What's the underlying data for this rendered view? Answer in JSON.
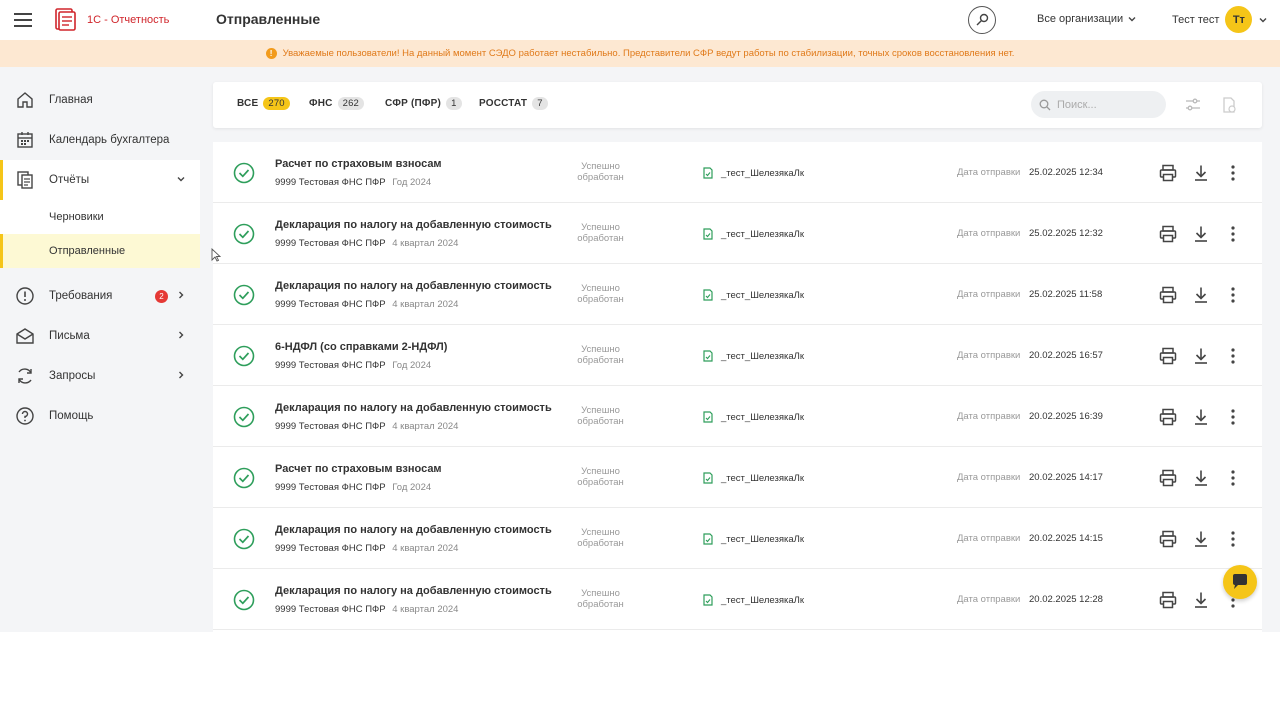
{
  "header": {
    "brand": "1С - Отчетность",
    "title": "Отправленные",
    "org_select": "Все организации",
    "user_name": "Тест тест",
    "avatar_initials": "Тт"
  },
  "alert": {
    "text": "Уважаемые пользователи! На данный момент СЭДО работает нестабильно. Представители СФР ведут работы по стабилизации, точных сроков восстановления нет."
  },
  "sidebar": {
    "items": [
      {
        "label": "Главная",
        "icon": "home-icon"
      },
      {
        "label": "Календарь бухгалтера",
        "icon": "calendar-icon"
      },
      {
        "label": "Отчёты",
        "icon": "reports-icon"
      },
      {
        "label": "Требования",
        "icon": "alert-circle-icon",
        "badge": "2"
      },
      {
        "label": "Письма",
        "icon": "mail-icon"
      },
      {
        "label": "Запросы",
        "icon": "refresh-icon"
      },
      {
        "label": "Помощь",
        "icon": "help-icon"
      }
    ],
    "sub_items": [
      {
        "label": "Черновики"
      },
      {
        "label": "Отправленные"
      }
    ]
  },
  "filters": {
    "tabs": [
      {
        "label": "ВСЕ",
        "count": "270"
      },
      {
        "label": "ФНС",
        "count": "262"
      },
      {
        "label": "СФР (ПФР)",
        "count": "1"
      },
      {
        "label": "РОССТАТ",
        "count": "7"
      }
    ],
    "search_placeholder": "Поиск..."
  },
  "reports": {
    "date_label": "Дата отправки",
    "rows": [
      {
        "title": "Расчет по страховым взносам",
        "code": "9999",
        "org": "Тестовая ФНС ПФР",
        "period": "Год 2024",
        "state_line1": "Успешно",
        "state_line2": "обработан",
        "signer": "_тест_ШелезякаЛк",
        "date": "25.02.2025 12:34"
      },
      {
        "title": "Декларация по налогу на добавленную стоимость",
        "code": "9999",
        "org": "Тестовая ФНС ПФР",
        "period": "4 квартал 2024",
        "state_line1": "Успешно",
        "state_line2": "обработан",
        "signer": "_тест_ШелезякаЛк",
        "date": "25.02.2025 12:32"
      },
      {
        "title": "Декларация по налогу на добавленную стоимость",
        "code": "9999",
        "org": "Тестовая ФНС ПФР",
        "period": "4 квартал 2024",
        "state_line1": "Успешно",
        "state_line2": "обработан",
        "signer": "_тест_ШелезякаЛк",
        "date": "25.02.2025 11:58"
      },
      {
        "title": "6-НДФЛ (со справками 2-НДФЛ)",
        "code": "9999",
        "org": "Тестовая ФНС ПФР",
        "period": "Год 2024",
        "state_line1": "Успешно",
        "state_line2": "обработан",
        "signer": "_тест_ШелезякаЛк",
        "date": "20.02.2025 16:57"
      },
      {
        "title": "Декларация по налогу на добавленную стоимость",
        "code": "9999",
        "org": "Тестовая ФНС ПФР",
        "period": "4 квартал 2024",
        "state_line1": "Успешно",
        "state_line2": "обработан",
        "signer": "_тест_ШелезякаЛк",
        "date": "20.02.2025 16:39"
      },
      {
        "title": "Расчет по страховым взносам",
        "code": "9999",
        "org": "Тестовая ФНС ПФР",
        "period": "Год 2024",
        "state_line1": "Успешно",
        "state_line2": "обработан",
        "signer": "_тест_ШелезякаЛк",
        "date": "20.02.2025 14:17"
      },
      {
        "title": "Декларация по налогу на добавленную стоимость",
        "code": "9999",
        "org": "Тестовая ФНС ПФР",
        "period": "4 квартал 2024",
        "state_line1": "Успешно",
        "state_line2": "обработан",
        "signer": "_тест_ШелезякаЛк",
        "date": "20.02.2025 14:15"
      },
      {
        "title": "Декларация по налогу на добавленную стоимость",
        "code": "9999",
        "org": "Тестовая ФНС ПФР",
        "period": "4 квартал 2024",
        "state_line1": "Успешно",
        "state_line2": "обработан",
        "signer": "_тест_ШелезякаЛк",
        "date": "20.02.2025 12:28"
      }
    ]
  },
  "colors": {
    "accent": "#f5c518",
    "brand": "#d0252b",
    "success": "#2e9e5b",
    "alert_text": "#e07a1a"
  }
}
